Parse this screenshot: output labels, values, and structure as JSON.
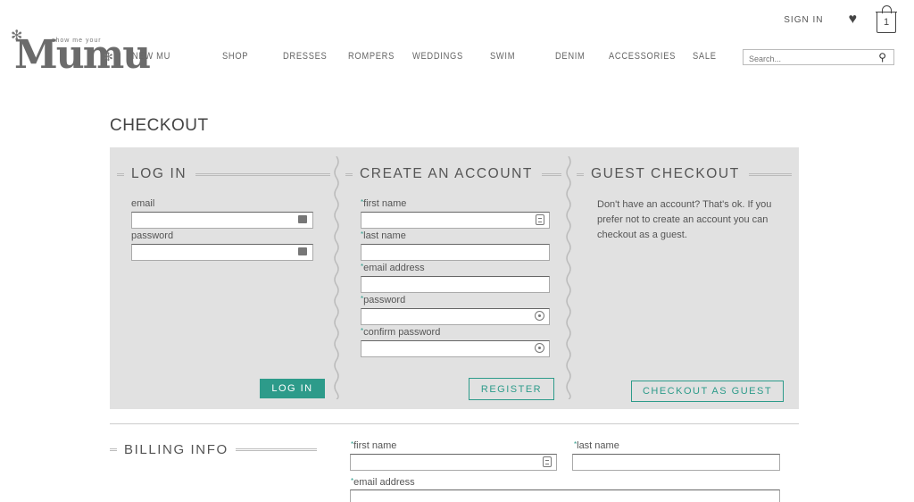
{
  "header": {
    "logo_tagline": "show me your",
    "logo_word": "Mumu",
    "sign_in": "SIGN IN",
    "bag_count": "1",
    "nav": [
      "NEW MU",
      "SHOP",
      "DRESSES",
      "ROMPERS",
      "WEDDINGS",
      "SWIM",
      "DENIM",
      "ACCESSORIES",
      "SALE"
    ],
    "search_placeholder": "Search..."
  },
  "page_title": "CHECKOUT",
  "login": {
    "title": "LOG IN",
    "email_label": "email",
    "password_label": "password",
    "button": "LOG IN"
  },
  "create": {
    "title": "CREATE AN ACCOUNT",
    "first_name": "first name",
    "last_name": "last name",
    "email": "email address",
    "password": "password",
    "confirm": "confirm password",
    "required_mark": "*",
    "button": "REGISTER"
  },
  "guest": {
    "title": "GUEST CHECKOUT",
    "text": "Don't have an account? That's ok. If you prefer not to create an account you can checkout as a guest.",
    "button": "CHECKOUT AS GUEST"
  },
  "billing": {
    "title": "BILLING INFO",
    "first_name": "first name",
    "last_name": "last name",
    "email": "email address",
    "required_mark": "*"
  },
  "colors": {
    "accent": "#2d9b8a",
    "panel_bg": "#e1e1e1"
  }
}
